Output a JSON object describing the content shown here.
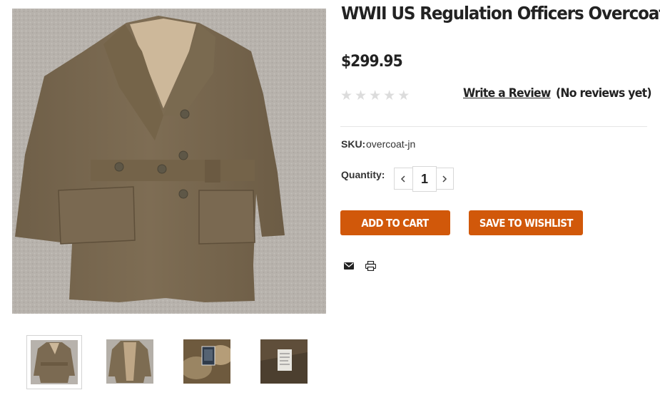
{
  "product": {
    "title": "WWII US Regulation Officers Overcoat",
    "price": "$299.95",
    "rating": {
      "stars_total": 5,
      "stars_filled": 0
    },
    "write_review_label": "Write a Review",
    "reviews_text": "(No reviews yet)",
    "sku_label": "SKU:",
    "sku_value": "overcoat-jn",
    "quantity_label": "Quantity:",
    "quantity_value": "1",
    "add_to_cart_label": "ADD TO CART",
    "wishlist_label": "SAVE TO WISHLIST"
  },
  "thumbnails": [
    {
      "name": "thumb-front",
      "active": true
    },
    {
      "name": "thumb-open",
      "active": false
    },
    {
      "name": "thumb-label",
      "active": false
    },
    {
      "name": "thumb-tag",
      "active": false
    }
  ],
  "share_icons": [
    "email-icon",
    "print-icon"
  ],
  "colors": {
    "accent": "#d1580a",
    "text": "#222222",
    "star_empty": "#dcdcdc",
    "coat": "#7b6a52",
    "carpet": "#b8b3ad"
  }
}
